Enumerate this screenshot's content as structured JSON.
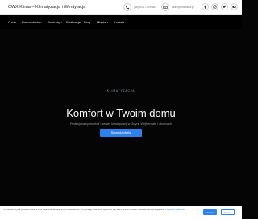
{
  "header": {
    "title": "CWX Klima – Klimatyzacja i Wentylacja",
    "phone": {
      "icon": "phone-icon",
      "text": "(48) 531 7-009 684"
    },
    "email": {
      "icon": "mail-icon",
      "text": "biuro@cwxklima.pl"
    },
    "social": [
      "facebook-icon",
      "instagram-icon",
      "twitter-icon",
      "youtube-icon"
    ]
  },
  "nav": {
    "items": [
      {
        "label": "O nas",
        "dropdown": false
      },
      {
        "label": "Nasza oferta",
        "dropdown": true
      },
      {
        "label": "Produkty",
        "dropdown": true
      },
      {
        "label": "Realizacje",
        "dropdown": false
      },
      {
        "label": "Blog",
        "dropdown": false
      },
      {
        "label": "Miasta",
        "dropdown": true
      },
      {
        "label": "Kontakt",
        "dropdown": false
      }
    ],
    "cta": "Napisz do nas"
  },
  "hero": {
    "eyebrow": "KLIMATYZACJA",
    "headline": "Komfort w Twoim domu",
    "subtitle": "Profesjonalny montaż i serwis klimatyzacji w Gdyni, Wejherowie i okolicach",
    "button": "Sprawdź ofertę"
  },
  "cookie": {
    "text": "Ten serwis używa plików cookies, w celu zapewnienia najlepszych doświadczeń. Korzystając z serwisu, zgadzasz się na ich użycie zgodnie z ustawieniami przeglądarki.",
    "link": "Polityka prywatności",
    "accept": "Akceptuj",
    "reject": "Odrzuć"
  },
  "colors": {
    "accent": "#2e80ec",
    "nav_bg": "#000000",
    "hero_bg": "#050505"
  }
}
